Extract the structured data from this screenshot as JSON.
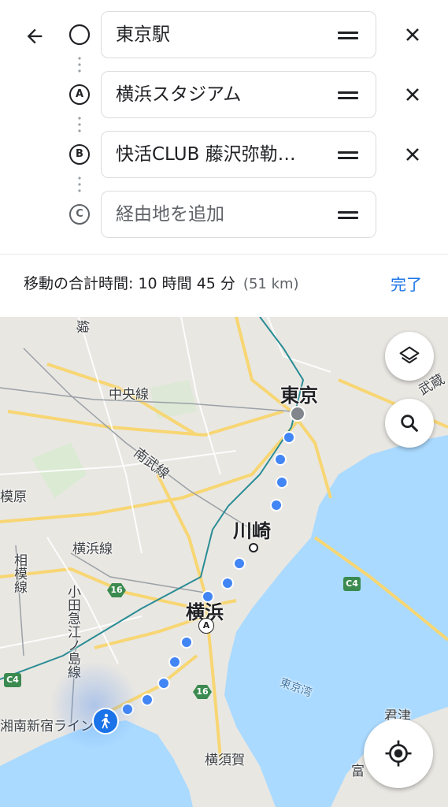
{
  "header": {
    "back_icon": "arrow-left-icon"
  },
  "stops": [
    {
      "marker": "origin-circle",
      "value": "東京駅",
      "placeholder": "",
      "removable": true
    },
    {
      "marker": "A",
      "value": "横浜スタジアム",
      "placeholder": "",
      "removable": true
    },
    {
      "marker": "B",
      "value": "快活CLUB 藤沢弥勒…",
      "placeholder": "",
      "removable": true
    },
    {
      "marker": "C",
      "value": "",
      "placeholder": "経由地を追加",
      "removable": false
    }
  ],
  "summary": {
    "label": "移動の合計時間: 10 時間 45 分",
    "distance": "(51 km)",
    "done_label": "完了",
    "done_color": "#1a73e8"
  },
  "map": {
    "labels": {
      "tokyo": "東京",
      "kawasaki": "川崎",
      "yokohama": "横浜",
      "yokosuka": "横須賀",
      "chuo_line": "中央線",
      "nambu_line": "南武線",
      "yokohama_line": "横浜線",
      "sagami_line": "相模線",
      "odakyu_line": "小田急江ノ島線",
      "shonan_line": "湘南新宿ライン",
      "musashino": "武蔵",
      "tokyo_bay": "東京湾",
      "kimitsu": "君津",
      "tomi": "富",
      "hara": "模原",
      "top": "線"
    },
    "shields": {
      "route16a": "16",
      "route16b": "16",
      "c4": "C4",
      "c4_left": "C4"
    },
    "marker_a": "A",
    "route_color": "#4285f4",
    "water_color": "#aadaff"
  },
  "controls": {
    "layers_icon": "layers-icon",
    "search_icon": "search-icon",
    "location_icon": "my-location-icon",
    "walk_icon": "walking-person-icon"
  }
}
